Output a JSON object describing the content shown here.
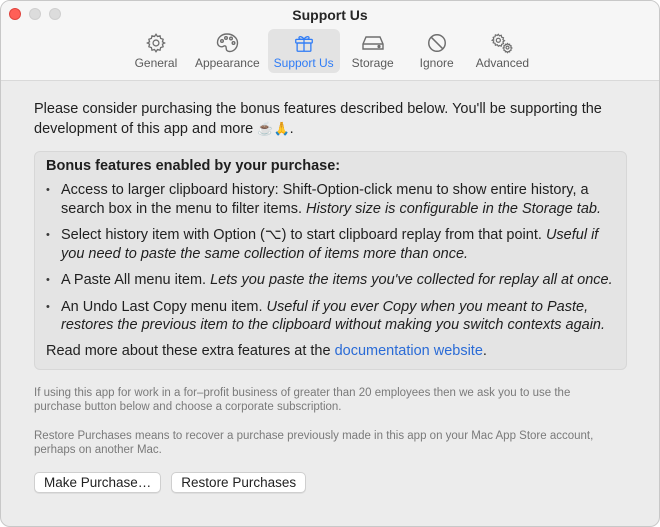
{
  "window": {
    "title": "Support Us"
  },
  "tabs": [
    {
      "label": "General",
      "icon": "gear-icon",
      "active": false
    },
    {
      "label": "Appearance",
      "icon": "palette-icon",
      "active": false
    },
    {
      "label": "Support Us",
      "icon": "gift-icon",
      "active": true
    },
    {
      "label": "Storage",
      "icon": "drive-icon",
      "active": false
    },
    {
      "label": "Ignore",
      "icon": "prohibited-icon",
      "active": false
    },
    {
      "label": "Advanced",
      "icon": "gears-icon",
      "active": false
    }
  ],
  "intro": {
    "text": "Please consider purchasing the bonus features described below. You'll be supporting the development of this app and more ",
    "emoji": "☕🙏",
    "end": "."
  },
  "features": {
    "title": "Bonus features enabled by your purchase:",
    "items": [
      {
        "text": "Access to larger clipboard history: Shift-Option-click menu to show entire history, a search box in the menu to filter items. ",
        "italic": "History size is configurable in the Storage tab."
      },
      {
        "text": "Select history item with Option (⌥) to start clipboard replay from that point. ",
        "italic": "Useful if you need to paste the same collection of items more than once."
      },
      {
        "text": "A Paste All menu item. ",
        "italic": "Lets you paste the items you've collected for replay all at once."
      },
      {
        "text": "An Undo Last Copy menu item. ",
        "italic": "Useful if you ever Copy when you meant to Paste, restores the previous item to the clipboard without making you switch contexts again."
      }
    ],
    "more_prefix": "Read more about these extra features at the ",
    "more_link": "documentation website",
    "more_suffix": "."
  },
  "notes": {
    "business": "If using this app for work in a for–profit business of greater than 20 employees then we ask you to use the purchase button below and choose a corporate subscription.",
    "restore": "Restore Purchases means to recover a purchase previously made in this app on your Mac App Store account, perhaps on another Mac."
  },
  "buttons": {
    "purchase": "Make Purchase…",
    "restore": "Restore Purchases"
  },
  "colors": {
    "accent": "#2f7cf6",
    "link": "#2a6bd6",
    "close": "#ff5f57"
  }
}
